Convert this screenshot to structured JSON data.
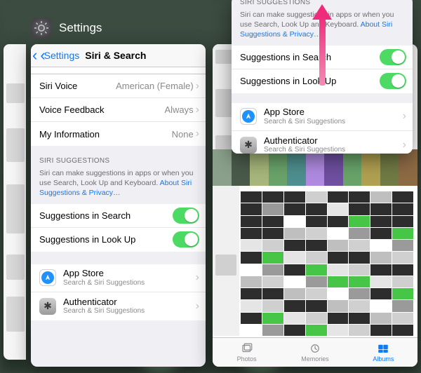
{
  "switcher": {
    "settings_label": "Settings"
  },
  "nav": {
    "back1_glyph": "‹",
    "back2_label": "Settings",
    "title": "Siri & Search",
    "chev_glyph": "›"
  },
  "siri": {
    "voice_label": "Siri Voice",
    "voice_value": "American (Female)",
    "feedback_label": "Voice Feedback",
    "feedback_value": "Always",
    "myinfo_label": "My Information",
    "myinfo_value": "None"
  },
  "sugg": {
    "header": "SIRI SUGGESTIONS",
    "sub_a": "Siri can make suggestions in apps or when you use Search, Look Up and Keyboard. ",
    "sub_link": "About Siri Suggestions & Privacy…",
    "search_label": "Suggestions in Search",
    "lookup_label": "Suggestions in Look Up"
  },
  "apps": {
    "appstore_name": "App Store",
    "appstore_sub": "Search & Siri Suggestions",
    "auth_name": "Authenticator",
    "auth_sub": "Search & Siri Suggestions",
    "auth_sub_trunc": "Search & Siri Suggestions"
  },
  "right": {
    "header": "SIRI SUGGESTIONS",
    "sub_a": "Siri can make suggestions in apps or when you use Search, Look Up and Keyboard. ",
    "sub_link": "About Siri Suggestions & Privacy…",
    "search_label": "Suggestions in Search",
    "lookup_label": "Suggestions in Look Up",
    "appstore_name": "App Store",
    "appstore_sub": "Search & Siri Suggestions",
    "auth_name": "Authenticator",
    "auth_sub": "Search & Siri Suggestions"
  },
  "tabs": {
    "photos": "Photos",
    "memories": "Memories",
    "albums": "Albums"
  },
  "colors": {
    "thumbs": [
      "#8aa08a",
      "#4a5a4a",
      "#a7b67a",
      "#6aa36a",
      "#4f8f8f",
      "#b08ae0",
      "#6e4fa0",
      "#6aa36a",
      "#b0a050",
      "#707a44",
      "#8c6a44"
    ]
  }
}
